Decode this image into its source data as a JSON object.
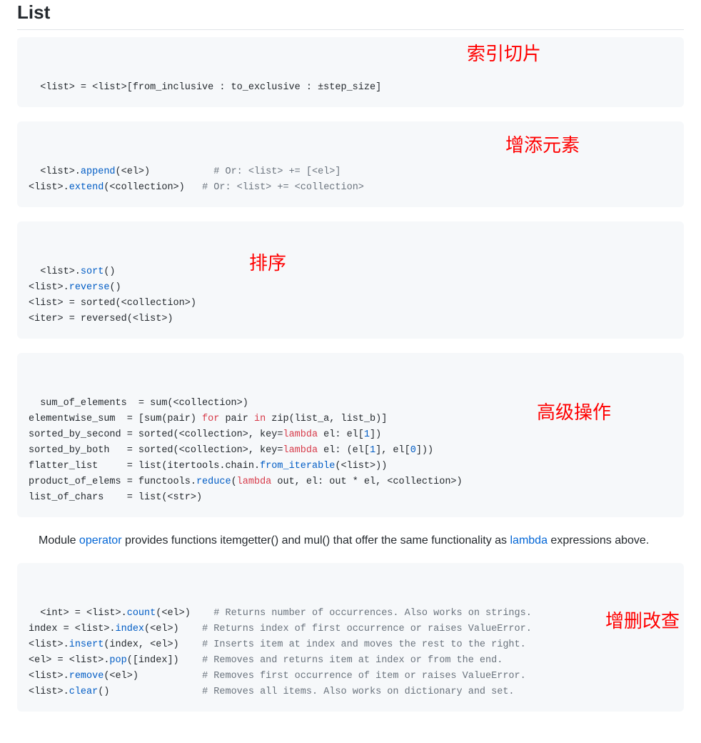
{
  "title": "List",
  "blocks": {
    "slicing": {
      "annotation": "索引切片",
      "text": "<list> = <list>[from_inclusive : to_exclusive : ±step_size]"
    },
    "append": {
      "annotation": "增添元素",
      "lines": [
        {
          "code": "<list>.append(<el>)",
          "comment": "# Or: <list> += [<el>]"
        },
        {
          "code": "<list>.extend(<collection>)",
          "comment": "# Or: <list> += <collection>"
        }
      ],
      "col": 30
    },
    "sort": {
      "annotation": "排序",
      "lines": [
        "<list>.sort()",
        "<list>.reverse()",
        "<list> = sorted(<collection>)",
        "<iter> = reversed(<list>)"
      ]
    },
    "advanced": {
      "annotation": "高级操作",
      "lines": [
        "sum_of_elements  = sum(<collection>)",
        "elementwise_sum  = [sum(pair) for pair in zip(list_a, list_b)]",
        "sorted_by_second = sorted(<collection>, key=lambda el: el[1])",
        "sorted_by_both   = sorted(<collection>, key=lambda el: (el[1], el[0]))",
        "flatter_list     = list(itertools.chain.from_iterable(<list>))",
        "product_of_elems = functools.reduce(lambda out, el: out * el, <collection>)",
        "list_of_chars    = list(<str>)"
      ]
    },
    "crud": {
      "annotation": "增删改查",
      "lines": [
        {
          "code": "<int> = <list>.count(<el>)",
          "comment": "# Returns number of occurrences. Also works on strings."
        },
        {
          "code": "index = <list>.index(<el>)",
          "comment": "# Returns index of first occurrence or raises ValueError."
        },
        {
          "code": "<list>.insert(index, <el>)",
          "comment": "# Inserts item at index and moves the rest to the right."
        },
        {
          "code": "<el> = <list>.pop([index])",
          "comment": "# Removes and returns item at index or from the end."
        },
        {
          "code": "<list>.remove(<el>)",
          "comment": "# Removes first occurrence of item or raises ValueError."
        },
        {
          "code": "<list>.clear()",
          "comment": "# Removes all items. Also works on dictionary and set."
        }
      ],
      "col": 30
    }
  },
  "note": {
    "prefix": "Module ",
    "link1": "operator",
    "middle": " provides functions itemgetter() and mul() that offer the same functionality as ",
    "link2": "lambda",
    "suffix": " expressions above."
  }
}
